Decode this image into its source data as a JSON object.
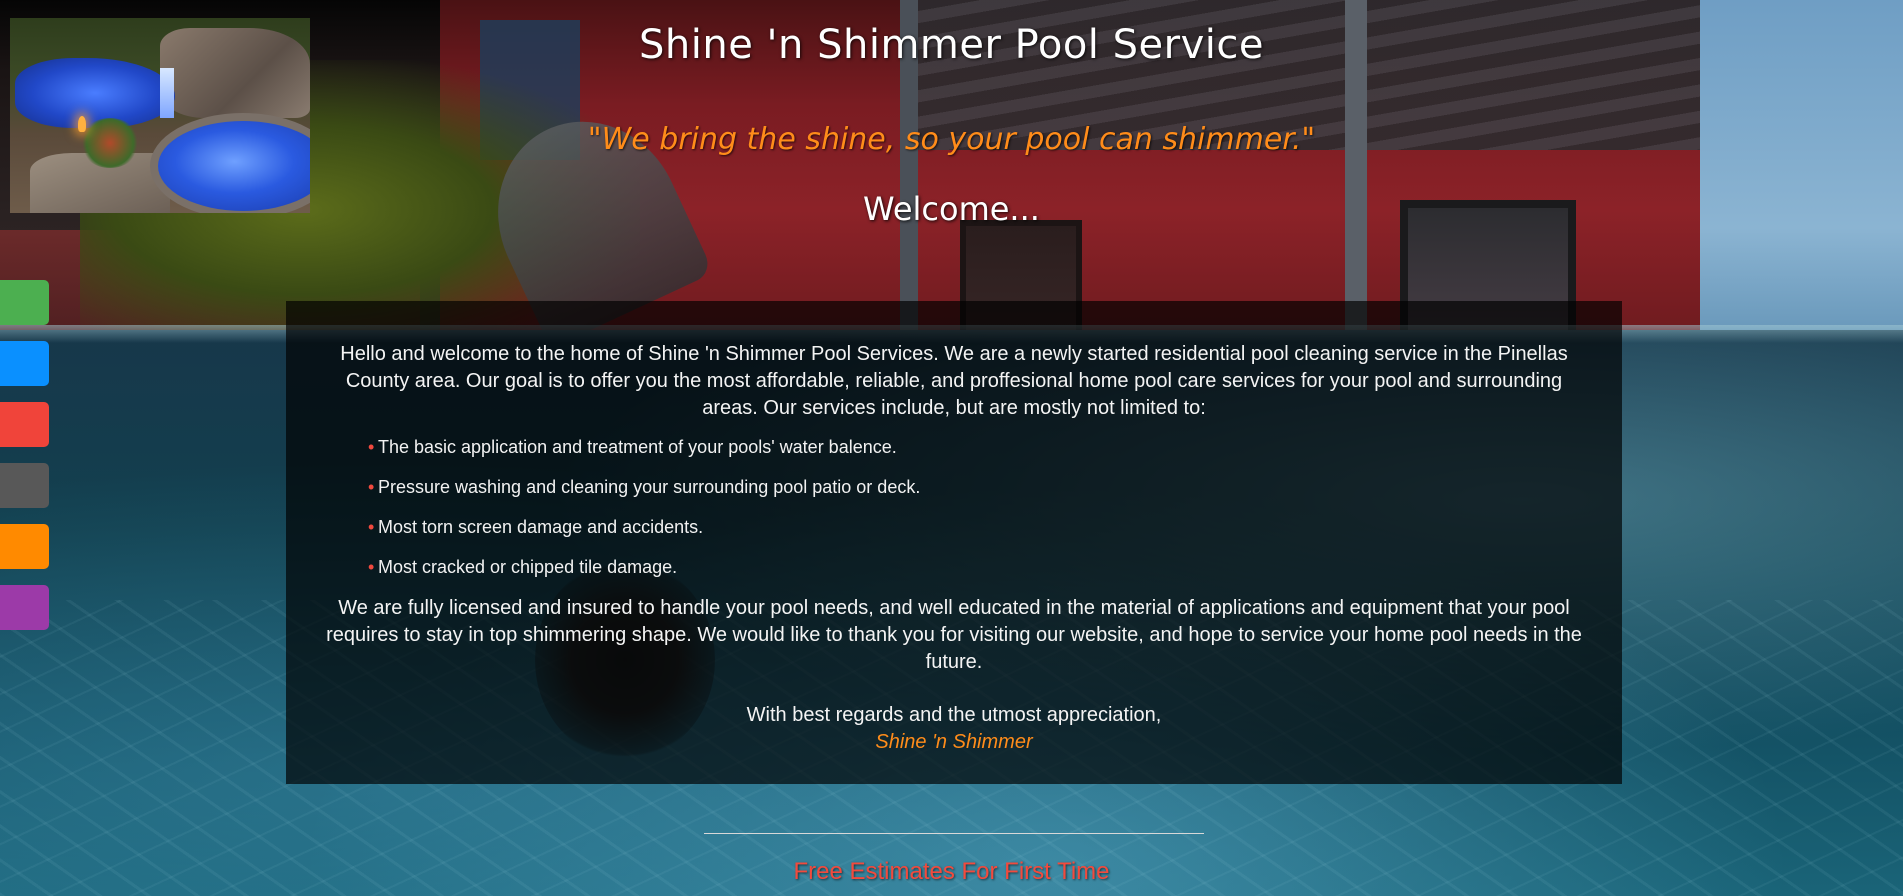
{
  "header": {
    "title": "Shine 'n Shimmer Pool Service",
    "tagline": "\"We bring the shine, so your pool can shimmer.\"",
    "welcome": "Welcome..."
  },
  "social": {
    "buttons": [
      {
        "color": "#4caf50"
      },
      {
        "color": "#0a90ff"
      },
      {
        "color": "#f0443a"
      },
      {
        "color": "#585858"
      },
      {
        "color": "#ff8a00"
      },
      {
        "color": "#9c3aa8"
      }
    ]
  },
  "content": {
    "intro": "Hello and welcome to the home of Shine 'n Shimmer Pool Services. We are a newly started residential pool cleaning service in the Pinellas County area. Our goal is to offer you the most affordable, reliable, and proffesional home pool care services for your pool and surrounding areas. Our services include, but are mostly not limited to:",
    "bullet_symbol": "•",
    "services": [
      "The basic application and treatment of your pools' water balence.",
      "Pressure washing and cleaning your surrounding pool patio or deck.",
      "Most torn screen damage and accidents.",
      "Most cracked or chipped tile damage."
    ],
    "closing": "We are fully licensed and insured to handle your pool needs, and well educated in the material of applications and equipment that your pool requires to stay in top shimmering shape. We would like to thank you for visiting our website, and hope to service your home pool needs in the future.",
    "regards": "With best regards and the utmost appreciation,",
    "signature": "Shine 'n Shimmer"
  },
  "footer": {
    "estimates": "Free Estimates For First Time"
  },
  "colors": {
    "accent_orange": "#ff8c1a",
    "accent_red": "#f24a3d",
    "panel_bg": "rgba(0,0,0,0.68)"
  }
}
